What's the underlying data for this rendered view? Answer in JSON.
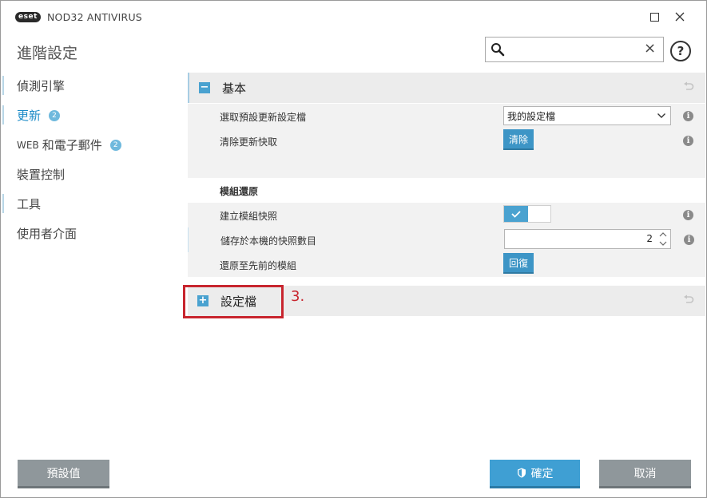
{
  "titlebar": {
    "logo": "eset",
    "app_title": "NOD32 ANTIVIRUS"
  },
  "header": {
    "page_title": "進階設定",
    "search_value": "",
    "search_placeholder": ""
  },
  "sidebar": {
    "items": [
      {
        "label": "偵測引擎"
      },
      {
        "label": "更新",
        "badge": "2"
      },
      {
        "prefix": "WEB",
        "label": "和電子郵件",
        "badge": "2"
      },
      {
        "label": "裝置控制"
      },
      {
        "label": "工具"
      },
      {
        "label": "使用者介面"
      }
    ]
  },
  "sections": {
    "basic": {
      "toggle": "−",
      "title": "基本",
      "rows": {
        "select_profile": {
          "label": "選取預設更新設定檔",
          "value": "我的設定檔"
        },
        "clear_cache": {
          "label": "清除更新快取",
          "button": "清除"
        },
        "module_rollback_heading": {
          "label": "模組還原"
        },
        "create_snapshots": {
          "label": "建立模組快照",
          "value": true
        },
        "snapshot_count": {
          "label": "儲存於本機的快照數目",
          "value": "2"
        },
        "rollback": {
          "label": "還原至先前的模組",
          "button": "回復"
        }
      }
    },
    "profiles": {
      "toggle": "+",
      "title": "設定檔"
    }
  },
  "annotation": {
    "text": "3."
  },
  "footer": {
    "default_label": "預設值",
    "ok_label": "確定",
    "cancel_label": "取消"
  },
  "colors": {
    "accent": "#3d95c6",
    "annotation": "#c8252e",
    "sidebar_active": "#1c8bc7"
  }
}
